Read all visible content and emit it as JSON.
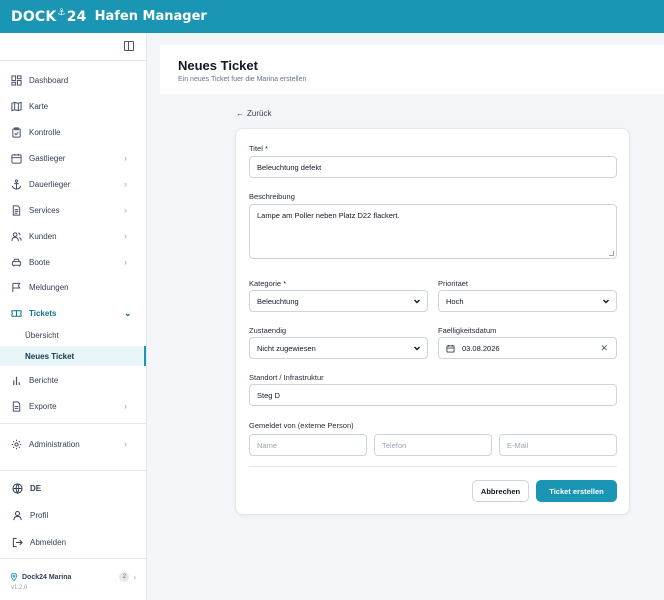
{
  "app": {
    "logo_text_left": "DOCK",
    "logo_text_right": "24",
    "title": "Hafen Manager",
    "brand_color": "#1a96b4"
  },
  "sidebar": {
    "items": [
      {
        "label": "Dashboard",
        "icon": "dashboard-icon",
        "has_chevron": false
      },
      {
        "label": "Karte",
        "icon": "map-icon",
        "has_chevron": false
      },
      {
        "label": "Kontrolle",
        "icon": "clipboard-check-icon",
        "has_chevron": false
      },
      {
        "label": "Gastlieger",
        "icon": "calendar-icon",
        "has_chevron": true
      },
      {
        "label": "Dauerlieger",
        "icon": "anchor-icon",
        "has_chevron": true
      },
      {
        "label": "Services",
        "icon": "document-icon",
        "has_chevron": true
      },
      {
        "label": "Kunden",
        "icon": "users-icon",
        "has_chevron": true
      },
      {
        "label": "Boote",
        "icon": "car-icon",
        "has_chevron": true
      },
      {
        "label": "Meldungen",
        "icon": "flag-icon",
        "has_chevron": false
      },
      {
        "label": "Tickets",
        "icon": "ticket-icon",
        "has_chevron": true,
        "expanded": true
      },
      {
        "label": "Berichte",
        "icon": "bar-chart-icon",
        "has_chevron": false
      },
      {
        "label": "Exporte",
        "icon": "file-export-icon",
        "has_chevron": true
      },
      {
        "label": "Administration",
        "icon": "gear-icon",
        "has_chevron": true
      }
    ],
    "sub_items": [
      {
        "label": "Übersicht",
        "active": false
      },
      {
        "label": "Neues Ticket",
        "active": true
      }
    ],
    "footer": {
      "language": "DE",
      "profile": "Profil",
      "logout": "Abmelden",
      "marina_name": "Dock24 Marina",
      "marina_badge": "2",
      "version": "v1.2.0"
    }
  },
  "page": {
    "title": "Neues Ticket",
    "subtitle": "Ein neues Ticket fuer die Marina erstellen",
    "back_label": "Zurück"
  },
  "form": {
    "title_label": "Titel *",
    "title_value": "Beleuchtung defekt",
    "description_label": "Beschreibung",
    "description_value": "Lampe am Poller neben Platz D22 flackert.",
    "category_label": "Kategorie *",
    "category_value": "Beleuchtung",
    "priority_label": "Prioritaet",
    "priority_value": "Hoch",
    "assignee_label": "Zustaendig",
    "assignee_value": "Nicht zugewiesen",
    "due_label": "Faelligkeitsdatum",
    "due_value": "03.08.2026",
    "location_label": "Standort / Infrastruktur",
    "location_value": "Steg D",
    "reporter_label": "Gemeldet von (externe Person)",
    "name_placeholder": "Name",
    "phone_placeholder": "Telefon",
    "email_placeholder": "E-Mail",
    "cancel_label": "Abbrechen",
    "submit_label": "Ticket erstellen"
  }
}
